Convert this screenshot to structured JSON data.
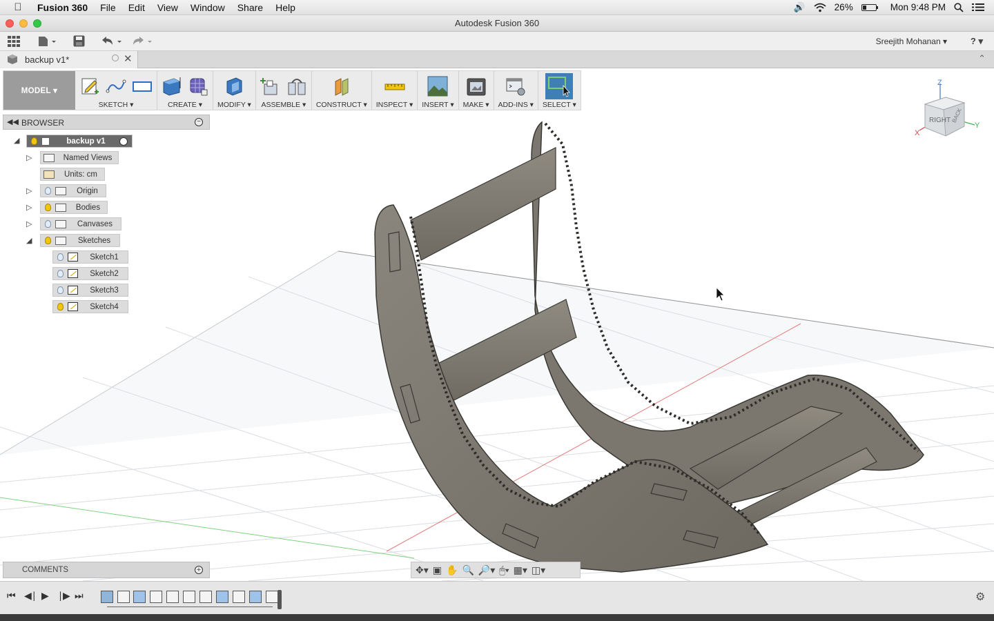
{
  "menubar": {
    "app": "Fusion 360",
    "items": [
      "File",
      "Edit",
      "View",
      "Window",
      "Share",
      "Help"
    ],
    "battery": "26%",
    "clock": "Mon 9:48 PM"
  },
  "window": {
    "title": "Autodesk Fusion 360"
  },
  "appbar": {
    "user": "Sreejith Mohanan ▾",
    "help": "? ▾"
  },
  "document_tab": {
    "name": "backup v1*"
  },
  "toolbar": {
    "workspace": "MODEL ▾",
    "groups": [
      {
        "label": "SKETCH ▾",
        "icons": [
          "sketch-pencil-icon",
          "spline-icon",
          "rectangle-icon"
        ]
      },
      {
        "label": "CREATE ▾",
        "icons": [
          "extrude-box-icon",
          "sphere-mesh-icon"
        ]
      },
      {
        "label": "MODIFY ▾",
        "icons": [
          "press-pull-icon"
        ]
      },
      {
        "label": "ASSEMBLE ▾",
        "icons": [
          "new-component-icon",
          "joint-icon"
        ]
      },
      {
        "label": "CONSTRUCT ▾",
        "icons": [
          "offset-plane-icon"
        ]
      },
      {
        "label": "INSPECT ▾",
        "icons": [
          "measure-icon"
        ]
      },
      {
        "label": "INSERT ▾",
        "icons": [
          "insert-image-icon"
        ]
      },
      {
        "label": "MAKE ▾",
        "icons": [
          "make-3d-print-icon"
        ]
      },
      {
        "label": "ADD-INS ▾",
        "icons": [
          "scripts-addins-icon"
        ]
      },
      {
        "label": "SELECT ▾",
        "icons": [
          "select-cursor-icon"
        ]
      }
    ]
  },
  "browser": {
    "title": "BROWSER",
    "root": "backup v1",
    "nodes": [
      {
        "label": "Named Views"
      },
      {
        "label": "Units: cm"
      },
      {
        "label": "Origin"
      },
      {
        "label": "Bodies"
      },
      {
        "label": "Canvases"
      },
      {
        "label": "Sketches"
      },
      {
        "label": "Sketch1"
      },
      {
        "label": "Sketch2"
      },
      {
        "label": "Sketch3"
      },
      {
        "label": "Sketch4"
      }
    ]
  },
  "viewcube": {
    "face": "RIGHT",
    "back": "BACK",
    "axis_z": "Z",
    "axis_x": "X",
    "axis_y": "Y"
  },
  "comments": {
    "title": "COMMENTS"
  },
  "colors": {
    "select_active": "#3f7fb4",
    "model_btn": "#9c9c9c",
    "part_body": "#7b766c"
  }
}
